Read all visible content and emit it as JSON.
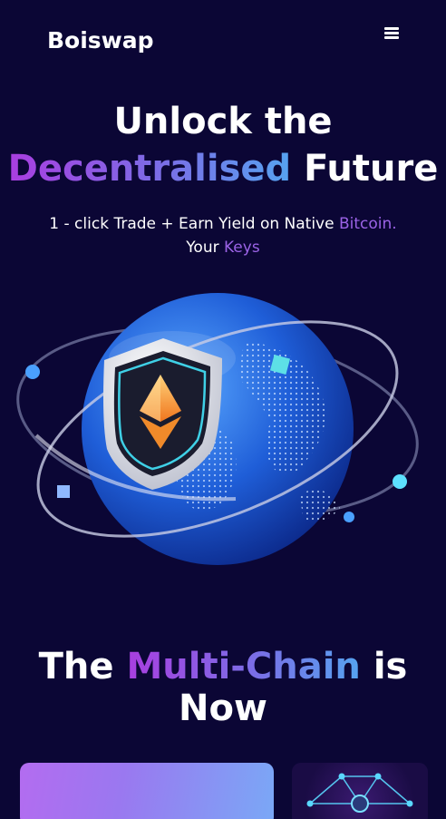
{
  "header": {
    "logo": "Boiswap",
    "menu_icon": "hamburger-menu-icon"
  },
  "hero": {
    "title_line1": "Unlock the",
    "title_highlight": "Decentralised",
    "title_rest": "Future",
    "subtitle_part1": "1 - click Trade + Earn Yield on Native",
    "subtitle_accent1": "Bitcoin.",
    "subtitle_part2": "Your",
    "subtitle_accent2": "Keys"
  },
  "illustration": {
    "name": "globe-shield-ethereum-illustration"
  },
  "section": {
    "title_part1": "The",
    "title_highlight": "Multi-Chain",
    "title_part2": "is",
    "title_part3": "Now"
  },
  "colors": {
    "background": "#0b0635",
    "accent_purple": "#9b63e6",
    "gradient_start": "#a93ee0",
    "gradient_end": "#56a3f0"
  }
}
